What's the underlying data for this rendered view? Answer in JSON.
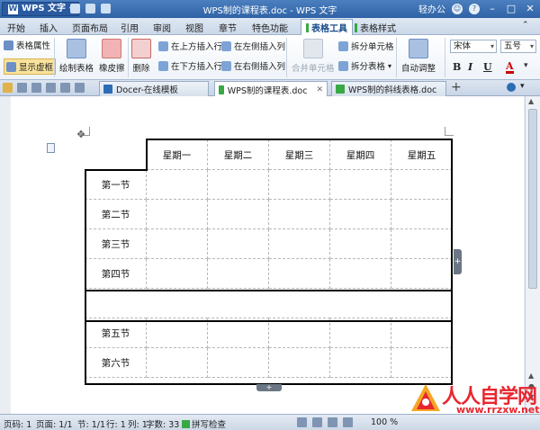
{
  "titlebar": {
    "app_button": "WPS 文字",
    "window_title": "WPS制的课程表.doc - WPS 文字",
    "account": "轻办公"
  },
  "menu": {
    "items": [
      "开始",
      "插入",
      "页面布局",
      "引用",
      "审阅",
      "视图",
      "章节",
      "特色功能"
    ],
    "context_tabs": [
      "表格工具",
      "表格样式"
    ]
  },
  "ribbon": {
    "table_props": "表格属性",
    "show_gridlines": "显示虚框",
    "draw_table": "绘制表格",
    "eraser": "橡皮擦",
    "delete": "删除",
    "insert_above": "在上方插入行",
    "insert_below": "在下方插入行",
    "insert_left": "在左侧插入列",
    "insert_right": "在右侧插入列",
    "merge_cells": "合并单元格",
    "split_cells": "拆分单元格",
    "split_table": "拆分表格",
    "auto_fit": "自动调整",
    "font_name": "宋体",
    "font_size": "五号",
    "bold": "B",
    "italic": "I",
    "underline": "U",
    "font_color": "A"
  },
  "doc_tabs": [
    {
      "label": "Docer-在线模板",
      "active": false
    },
    {
      "label": "WPS制的课程表.doc",
      "active": true
    },
    {
      "label": "WPS制的斜线表格.doc",
      "active": false
    }
  ],
  "timetable": {
    "days": [
      "星期一",
      "星期二",
      "星期三",
      "星期四",
      "星期五"
    ],
    "morning": [
      "第一节",
      "第二节",
      "第三节",
      "第四节"
    ],
    "afternoon": [
      "第五节",
      "第六节"
    ]
  },
  "status": {
    "page": "页码: 1",
    "pages": "页面: 1/1",
    "section": "节: 1/1",
    "line": "行: 1",
    "column": "列: 1",
    "word_count": "字数: 33",
    "spell_check": "拼写检查",
    "zoom": "100 %"
  },
  "watermark": {
    "brand": "人人自学网",
    "url": "www.rrzxw.net"
  },
  "colors": {
    "titlebar": "#2f63a6",
    "context_tab_accent": "#39a845",
    "watermark_red": "#e8262f"
  }
}
